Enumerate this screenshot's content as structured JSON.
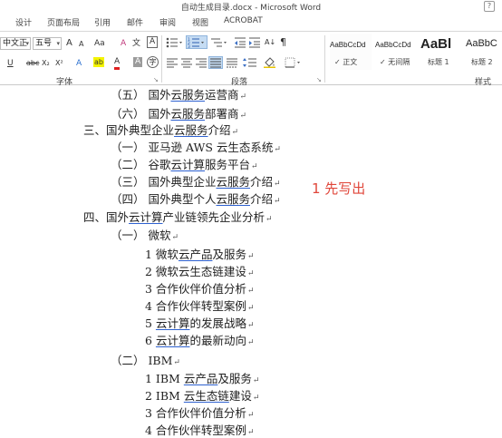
{
  "window": {
    "title": "自动生成目录.docx - Microsoft Word",
    "help": "?"
  },
  "tabs": [
    "设计",
    "页面布局",
    "引用",
    "邮件",
    "审阅",
    "视图",
    "ACROBAT"
  ],
  "ribbon": {
    "font": {
      "name": "中文正",
      "size": "五号",
      "grow": "A",
      "shrink": "A",
      "case": "Aa",
      "clear": "A",
      "phonetic": "文",
      "border": "A",
      "underline": "U",
      "strike": "abc",
      "subscript": "X₂",
      "superscript": "X²",
      "effects": "A",
      "highlight": "ab",
      "color": "A",
      "shade": "A",
      "enclose": "字",
      "label": "字体"
    },
    "paragraph": {
      "label": "段落",
      "sort": "A↓",
      "marks": "¶"
    },
    "styles": {
      "label": "样式",
      "items": [
        {
          "sample": "AaBbCcDd",
          "name": "正文"
        },
        {
          "sample": "AaBbCcDd",
          "name": "无间隔"
        },
        {
          "sample": "AaBl",
          "name": "标题 1"
        },
        {
          "sample": "AaBbC",
          "name": "标题 2"
        }
      ],
      "check": "✓"
    },
    "launcher": "↘"
  },
  "document": {
    "mark": "↵",
    "annotation": "1 先写出",
    "lines": [
      {
        "pre": "（五）  国外",
        "u": "云服务",
        "post": "运营商"
      },
      {
        "pre": "（六）  国外",
        "u": "云服务",
        "post": "部署商"
      },
      {
        "pre": "三、国外典型企业",
        "u": "云服务",
        "post": "介绍"
      },
      {
        "pre": "（一）  亚马逊 AWS 云生态系统",
        "u": "",
        "post": ""
      },
      {
        "pre": "（二）  谷歌",
        "u": "云计算",
        "post": "服务平台"
      },
      {
        "pre": "（三）  国外典型企业",
        "u": "云服务",
        "post": "介绍"
      },
      {
        "pre": "（四）  国外典型个人",
        "u": "云服务",
        "post": "介绍"
      },
      {
        "pre": "四、国外",
        "u": "云计算",
        "post": "产业链领先企业分析"
      },
      {
        "pre": "（一）  微软",
        "u": "",
        "post": ""
      },
      {
        "pre": "1   微软",
        "u": "云产品",
        "post": "及服务"
      },
      {
        "pre": "2   微软云生态链建设",
        "u": "",
        "post": ""
      },
      {
        "pre": "3   合作伙伴价值分析",
        "u": "",
        "post": ""
      },
      {
        "pre": "4   合作伙伴转型案例",
        "u": "",
        "post": ""
      },
      {
        "pre": "5   ",
        "u": "云计算",
        "post": "的发展战略"
      },
      {
        "pre": "6   ",
        "u": "云计算",
        "post": "的最新动向"
      },
      {
        "pre": "（二）  IBM",
        "u": "",
        "post": ""
      },
      {
        "pre": "1   IBM ",
        "u": "云产品",
        "post": "及服务"
      },
      {
        "pre": "2   IBM ",
        "u": "云生态链",
        "post": "建设"
      },
      {
        "pre": "3   合作伙伴价值分析",
        "u": "",
        "post": ""
      },
      {
        "pre": "4   合作伙伴转型案例",
        "u": "",
        "post": ""
      }
    ]
  }
}
